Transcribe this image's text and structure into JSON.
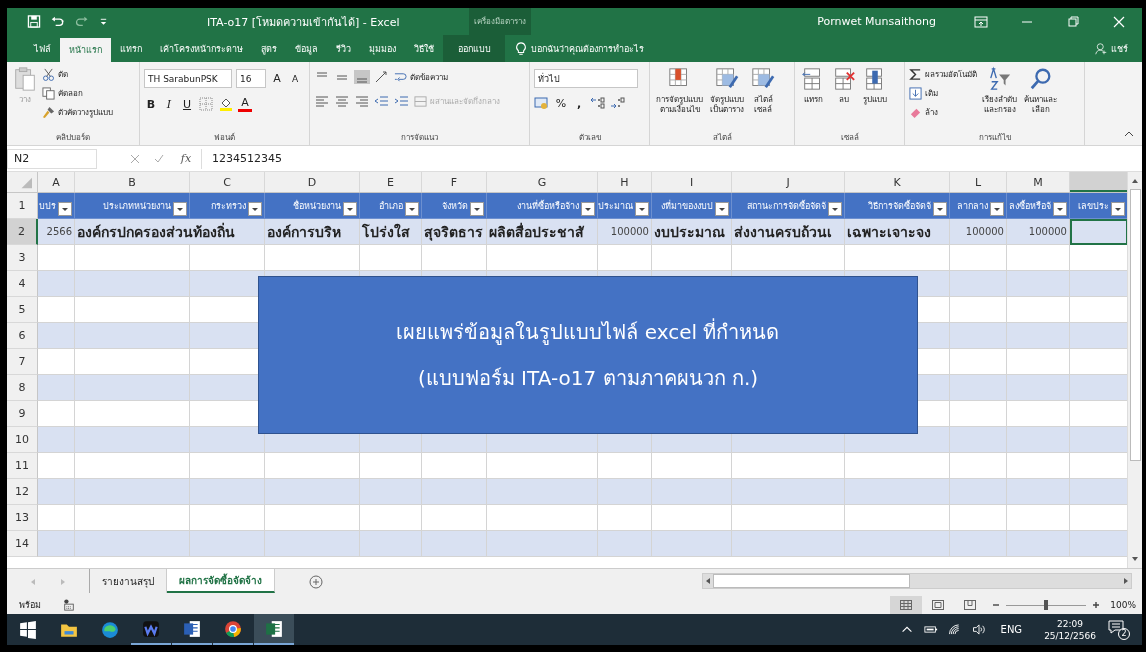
{
  "title_bar": {
    "title": "ITA-o17 [โหมดความเข้ากันได้] - Excel",
    "context_label": "เครื่องมือตาราง",
    "user": "Pornwet Munsaithong"
  },
  "ribbon_tabs": [
    {
      "label": "ไฟล์",
      "selected": false,
      "kind": "standard"
    },
    {
      "label": "หน้าแรก",
      "selected": true,
      "kind": "standard"
    },
    {
      "label": "แทรก",
      "selected": false,
      "kind": "standard"
    },
    {
      "label": "เค้าโครงหน้ากระดาษ",
      "selected": false,
      "kind": "standard"
    },
    {
      "label": "สูตร",
      "selected": false,
      "kind": "standard"
    },
    {
      "label": "ข้อมูล",
      "selected": false,
      "kind": "standard"
    },
    {
      "label": "รีวิว",
      "selected": false,
      "kind": "standard"
    },
    {
      "label": "มุมมอง",
      "selected": false,
      "kind": "standard"
    },
    {
      "label": "วิธีใช้",
      "selected": false,
      "kind": "standard"
    },
    {
      "label": "ออกแบบ",
      "selected": false,
      "kind": "contextual"
    }
  ],
  "tell_me": "บอกฉันว่าคุณต้องการทำอะไร",
  "share": "แชร์",
  "ribbon": {
    "clipboard": {
      "label": "คลิปบอร์ด",
      "paste": "วาง",
      "cut": "ตัด",
      "copy": "คัดลอก",
      "format_painter": "ตัวคัดวางรูปแบบ"
    },
    "font": {
      "label": "ฟอนต์",
      "font_name": "TH SarabunPSK",
      "font_size": "16",
      "grow": "A",
      "shrink": "A",
      "bold": "B",
      "italic": "I",
      "underline": "U",
      "font_color": "A"
    },
    "alignment": {
      "label": "การจัดแนว",
      "vertical": [
        {
          "selected": false
        },
        {
          "selected": false
        },
        {
          "selected": true
        }
      ],
      "wrap_text": "ตัดข้อความ",
      "merge": {
        "label": "ผสานและจัดกึ่งกลาง",
        "disabled": true
      }
    },
    "number": {
      "label": "ตัวเลข",
      "format": "ทั่วไป",
      "percent": "%",
      "comma": ","
    },
    "styles": {
      "label": "สไตล์",
      "buttons": [
        {
          "lines": [
            "การจัดรูปแบบ",
            "ตามเงื่อนไข"
          ]
        },
        {
          "lines": [
            "จัดรูปแบบ",
            "เป็นตาราง"
          ]
        },
        {
          "lines": [
            "สไตล์",
            "เซลล์"
          ]
        }
      ]
    },
    "cells": {
      "label": "เซลล์",
      "buttons": [
        "แทรก",
        "ลบ",
        "รูปแบบ"
      ]
    },
    "editing": {
      "label": "การแก้ไข",
      "autosum": "ผลรวมอัตโนมัติ",
      "fill": "เติม",
      "clear": "ล้าง",
      "sort": [
        "เรียงลำดับ",
        "และกรอง"
      ],
      "find": [
        "ค้นหาและ",
        "เลือก"
      ]
    }
  },
  "formula_bar": {
    "name_box": "N2",
    "fx": "fx",
    "formula": "1234512345"
  },
  "columns": [
    {
      "letter": "A",
      "selected": false
    },
    {
      "letter": "B",
      "selected": false
    },
    {
      "letter": "C",
      "selected": false
    },
    {
      "letter": "D",
      "selected": false
    },
    {
      "letter": "E",
      "selected": false
    },
    {
      "letter": "F",
      "selected": false
    },
    {
      "letter": "G",
      "selected": false
    },
    {
      "letter": "H",
      "selected": false
    },
    {
      "letter": "I",
      "selected": false
    },
    {
      "letter": "J",
      "selected": false
    },
    {
      "letter": "K",
      "selected": false
    },
    {
      "letter": "L",
      "selected": false
    },
    {
      "letter": "M",
      "selected": false
    },
    {
      "selected": true
    }
  ],
  "rows": [
    {
      "number": "1",
      "selected": false,
      "kind": "header",
      "cells": [
        "บปร",
        "ประเภทหน่วยงาน",
        "กระทรวง",
        "ชื่อหน่วยงาน",
        "อำเภอ",
        "จังหวัด",
        "งานที่ซื้อหรือจ้าง",
        "ประมาณ",
        "งที่มาของงบป",
        "สถานะการจัดซื้อจัดจ้",
        "วิธีการจัดซื้อจัดจ้",
        "ลากลาง",
        "ลงซื้อหรือจ้",
        "เลขประ"
      ]
    },
    {
      "number": "2",
      "selected": true,
      "kind": "data",
      "cells": [
        {
          "text": "2566",
          "kind": "number"
        },
        {
          "text": "องค์กรปกครองส่วนท้องถิ่น",
          "kind": "text"
        },
        null,
        {
          "text": "องค์การบริห",
          "kind": "text"
        },
        {
          "text": "โปร่งใส",
          "kind": "text"
        },
        {
          "text": "สุจริตธาร",
          "kind": "text"
        },
        {
          "text": "ผลิตสื่อประชาสั",
          "kind": "text"
        },
        {
          "text": "100000",
          "kind": "number"
        },
        {
          "text": "งบประมาณ",
          "kind": "text"
        },
        {
          "text": "ส่งงานครบถ้วนเ",
          "kind": "text"
        },
        {
          "text": "เฉพาะเจาะจง",
          "kind": "text"
        },
        {
          "text": "100000",
          "kind": "number"
        },
        {
          "text": "100000",
          "kind": "number"
        },
        null
      ]
    },
    {
      "number": "3",
      "selected": false,
      "kind": "data"
    },
    {
      "number": "4",
      "selected": false,
      "kind": "data"
    },
    {
      "number": "5",
      "selected": false,
      "kind": "data"
    },
    {
      "number": "6",
      "selected": false,
      "kind": "data"
    },
    {
      "number": "7",
      "selected": false,
      "kind": "data"
    },
    {
      "number": "8",
      "selected": false,
      "kind": "data"
    },
    {
      "number": "9",
      "selected": false,
      "kind": "data"
    },
    {
      "number": "10",
      "selected": false,
      "kind": "data"
    },
    {
      "number": "11",
      "selected": false,
      "kind": "data"
    },
    {
      "number": "12",
      "selected": false,
      "kind": "data"
    },
    {
      "number": "13",
      "selected": false,
      "kind": "data"
    },
    {
      "number": "14",
      "selected": false,
      "kind": "data"
    }
  ],
  "text_box": {
    "lines": [
      "เผยแพร่ข้อมูลในรูปแบบไฟล์ excel ที่กำหนด",
      "(แบบฟอร์ม ITA-o17 ตามภาคผนวก ก.)"
    ]
  },
  "sheet_tabs": [
    {
      "label": "รายงานสรุป",
      "selected": false
    },
    {
      "label": "ผลการจัดซื้อจัดจ้าง",
      "selected": true
    }
  ],
  "status_bar": {
    "status": "พร้อม",
    "views": [
      {
        "selected": true
      },
      {
        "selected": false
      },
      {
        "selected": false
      }
    ],
    "zoom": {
      "level": 0.5,
      "reading": "100%"
    }
  },
  "taskbar": {
    "apps": [
      {
        "kind": "start",
        "running": false,
        "active": false
      },
      {
        "kind": "folder",
        "running": false,
        "active": false
      },
      {
        "kind": "edge",
        "running": false,
        "active": false
      },
      {
        "kind": "wave",
        "running": true,
        "active": false
      },
      {
        "kind": "word",
        "running": true,
        "active": false
      },
      {
        "kind": "chrome",
        "running": true,
        "active": false
      },
      {
        "kind": "excel",
        "running": true,
        "active": true
      }
    ],
    "language": "ENG",
    "time": "22:09",
    "date": "25/12/2566",
    "notifications": "2"
  }
}
